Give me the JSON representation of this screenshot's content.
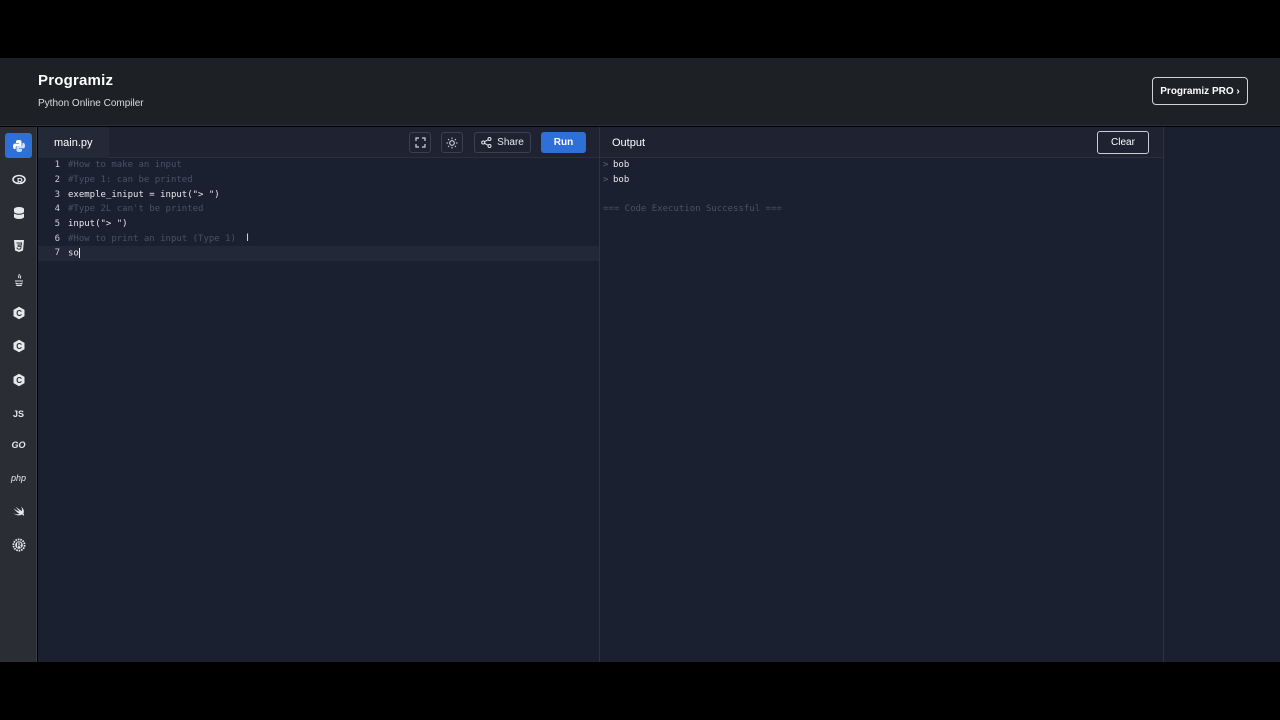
{
  "header": {
    "logo": "Programiz",
    "subtitle": "Python Online Compiler",
    "pro_button": "Programiz PRO ›"
  },
  "sidebar": {
    "items": [
      {
        "icon": "python-icon",
        "active": true
      },
      {
        "icon": "r-icon",
        "active": false
      },
      {
        "icon": "sql-icon",
        "active": false
      },
      {
        "icon": "html5-icon",
        "active": false
      },
      {
        "icon": "java-icon",
        "active": false
      },
      {
        "icon": "c-icon",
        "active": false
      },
      {
        "icon": "cpp-icon",
        "active": false
      },
      {
        "icon": "csharp-icon",
        "active": false
      },
      {
        "icon": "js-icon",
        "label": "JS",
        "active": false
      },
      {
        "icon": "go-icon",
        "label": "GO",
        "active": false
      },
      {
        "icon": "php-icon",
        "label": "php",
        "active": false
      },
      {
        "icon": "swift-icon",
        "active": false
      },
      {
        "icon": "rust-icon",
        "active": false
      }
    ]
  },
  "editor": {
    "file_name": "main.py",
    "share_label": "Share",
    "run_label": "Run",
    "lines": [
      {
        "n": "1",
        "text": "#How to make an input",
        "kind": "comment"
      },
      {
        "n": "2",
        "text": "#Type 1: can be printed",
        "kind": "comment"
      },
      {
        "n": "3",
        "text": "exemple_iniput = input(\"> \")",
        "kind": "normal"
      },
      {
        "n": "4",
        "text": "#Type 2L can't be printed",
        "kind": "comment"
      },
      {
        "n": "5",
        "text": "input(\"> \")",
        "kind": "normal"
      },
      {
        "n": "6",
        "text": "#How to print an input (Type 1)",
        "kind": "comment"
      },
      {
        "n": "7",
        "text": "so",
        "kind": "normal"
      }
    ]
  },
  "output": {
    "title": "Output",
    "clear_label": "Clear",
    "prompt_symbol": ">",
    "lines": [
      "bob",
      "bob"
    ],
    "status": "=== Code Execution Successful ==="
  },
  "colors": {
    "accent": "#2f6fd8",
    "editor_bg": "#1b2030",
    "header_bg": "#1d2025",
    "comment": "#4a5162"
  }
}
